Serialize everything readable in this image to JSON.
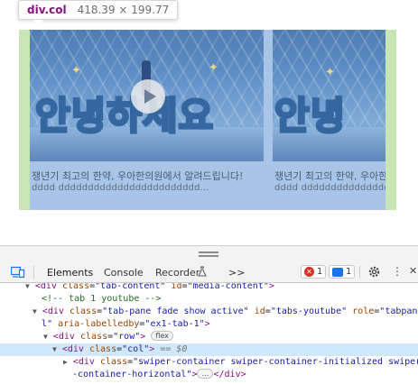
{
  "tooltip": {
    "selector": "div.col",
    "dimensions": "418.39 × 199.77"
  },
  "slides": [
    {
      "thumb_text": "안녕하세요",
      "caption": "쟁년기 최고의 한약, 우아한의원에서 알려드립니다!",
      "description": "dddd dddddddddddddddddddddddd..."
    },
    {
      "thumb_text": "안녕",
      "caption": "쟁년기 최고의 한약, 우아한의",
      "description": "dddd dddddddddddddddddddd"
    }
  ],
  "devtools": {
    "tabs": [
      "Elements",
      "Console",
      "Recorder",
      ">>"
    ],
    "active_tab": "Elements",
    "error_count": "1",
    "message_count": "1"
  },
  "dom": {
    "line1": {
      "tag": "div",
      "attr": "class",
      "val": "tab-content",
      "attr2": "id",
      "val2": "media-content",
      "close": ">"
    },
    "line2": {
      "comment": "<!-- tab 1 youtube -->"
    },
    "line3": {
      "tag": "div",
      "attr": "class",
      "val": "tab-pane fade show active",
      "attr2": "id",
      "val2": "tabs-youtube",
      "attr3": "role",
      "val3": "tabpane"
    },
    "line4": {
      "cont": "l\"",
      "attr": "aria-labelledby",
      "val": "ex1-tab-1",
      "close": ">"
    },
    "line5": {
      "tag": "div",
      "attr": "class",
      "val": "row",
      "close": ">",
      "badge": "flex"
    },
    "line6": {
      "tag": "div",
      "attr": "class",
      "val": "col",
      "close": ">",
      "eq": "== $0"
    },
    "line7": {
      "tag": "div",
      "attr": "class",
      "val": "swiper-container swiper-container-initialized swiper"
    },
    "line8": {
      "cont": "-container-horizontal\"",
      "close": ">",
      "ellipsis": "…",
      "end": "</div>"
    }
  }
}
